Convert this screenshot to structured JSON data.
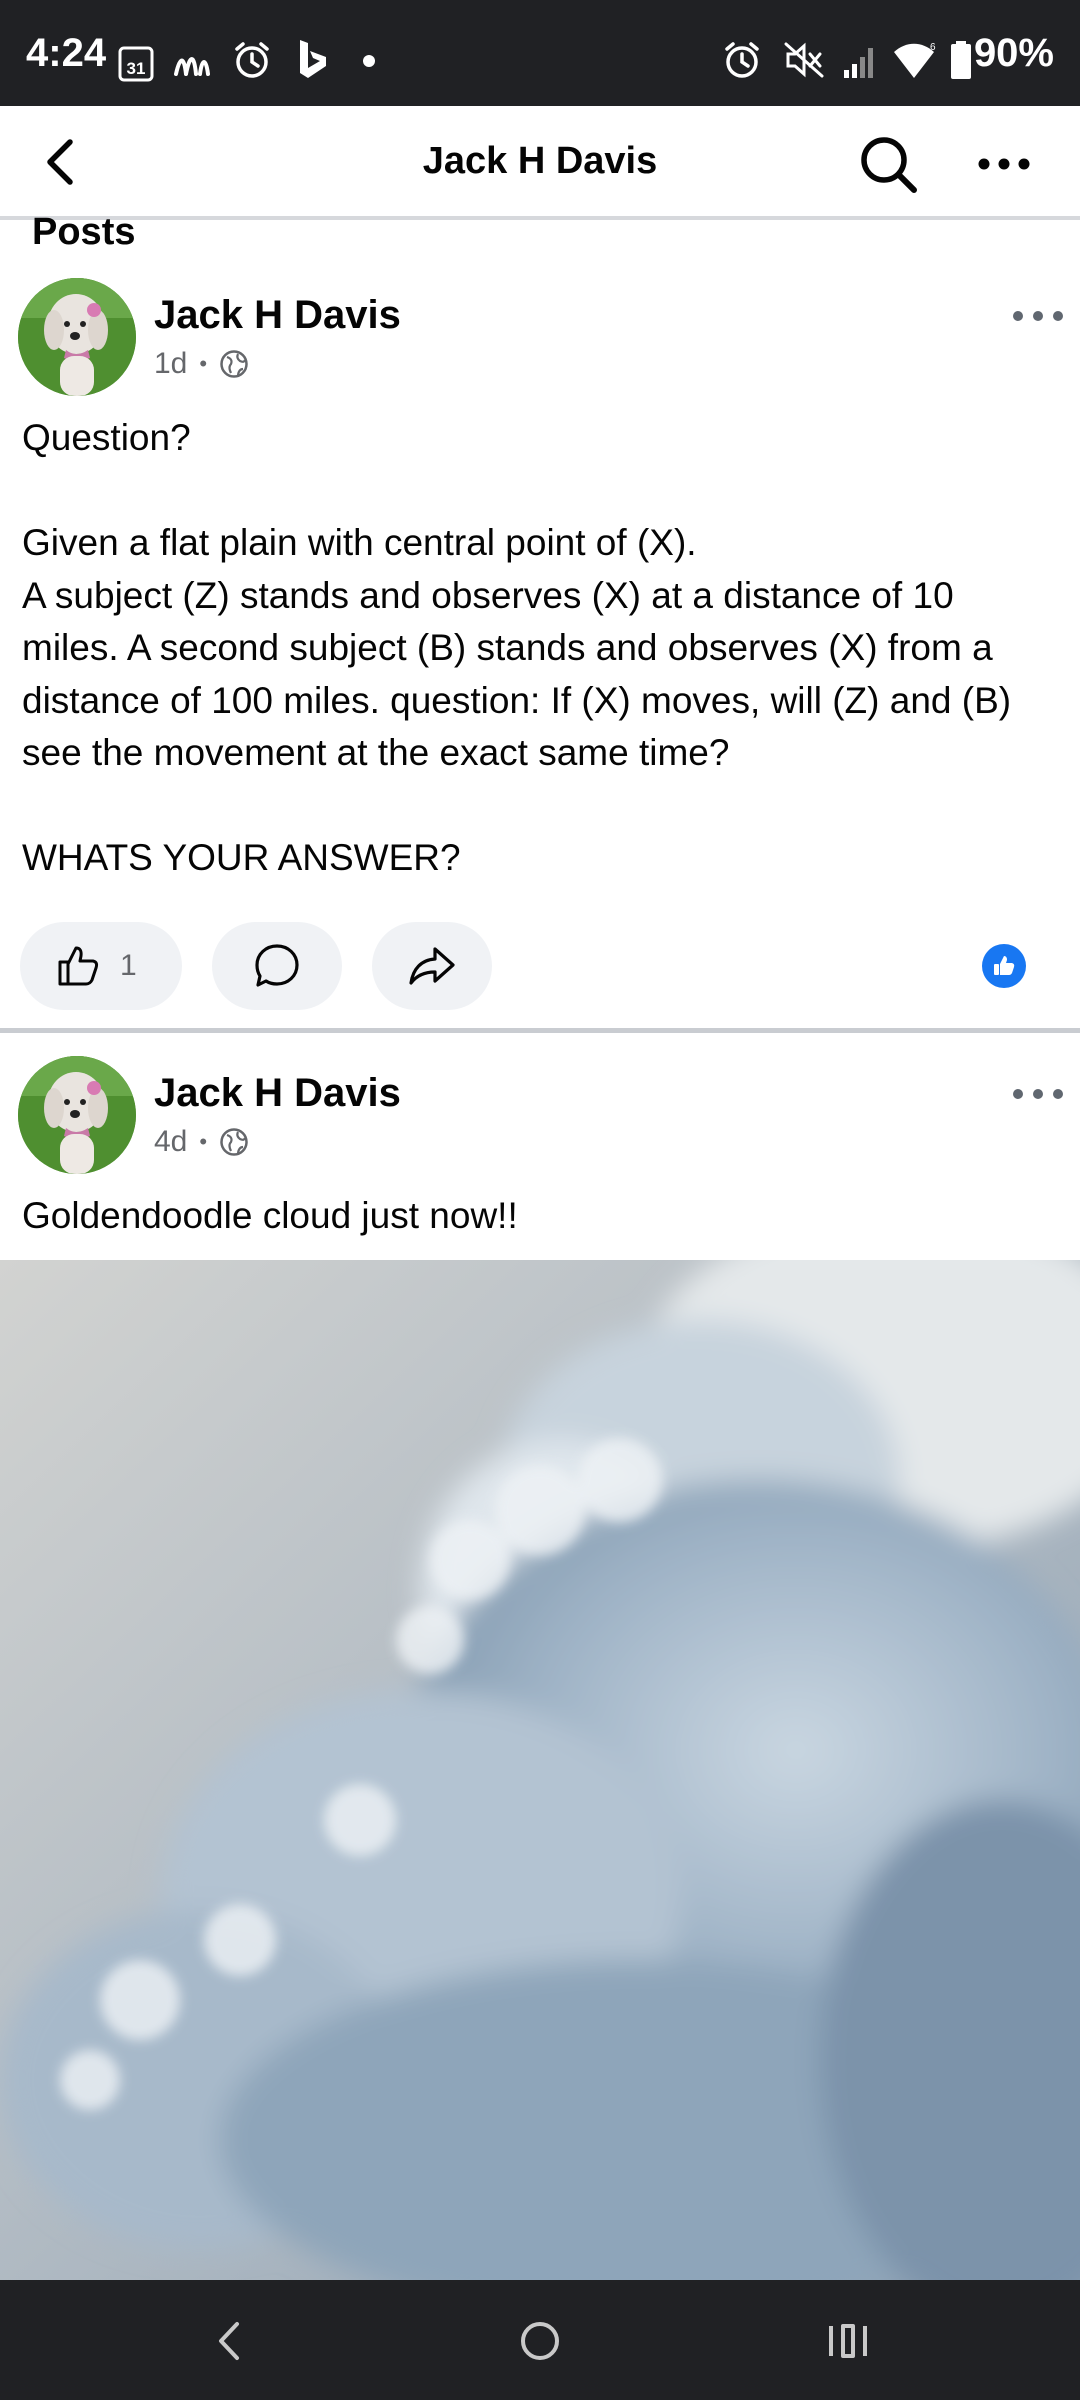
{
  "status_bar": {
    "time": "4:24",
    "calendar_day": "31",
    "battery": "90%"
  },
  "header": {
    "title": "Jack H Davis"
  },
  "section": {
    "label": "Posts"
  },
  "posts": [
    {
      "author": "Jack H Davis",
      "time": "1d",
      "audience_icon": "globe-icon",
      "text": "Question?\n\nGiven a flat plain with central point of (X).\nA subject (Z) stands and observes (X) at a distance of 10 miles. A second subject (B) stands and observes (X) from a distance of 100 miles. question: If (X) moves, will (Z) and (B) see the movement at the exact same time?\n\nWHATS YOUR ANSWER?",
      "like_count": "1",
      "reaction_icon": "like-reaction-icon"
    },
    {
      "author": "Jack H Davis",
      "time": "4d",
      "audience_icon": "globe-icon",
      "text": "Goldendoodle cloud just now!!",
      "image": "cloud-photo"
    }
  ],
  "colors": {
    "brand_blue": "#1877f2",
    "status_bar": "#202124",
    "secondary_text": "#65676b",
    "pill_bg": "#f0f2f5"
  }
}
